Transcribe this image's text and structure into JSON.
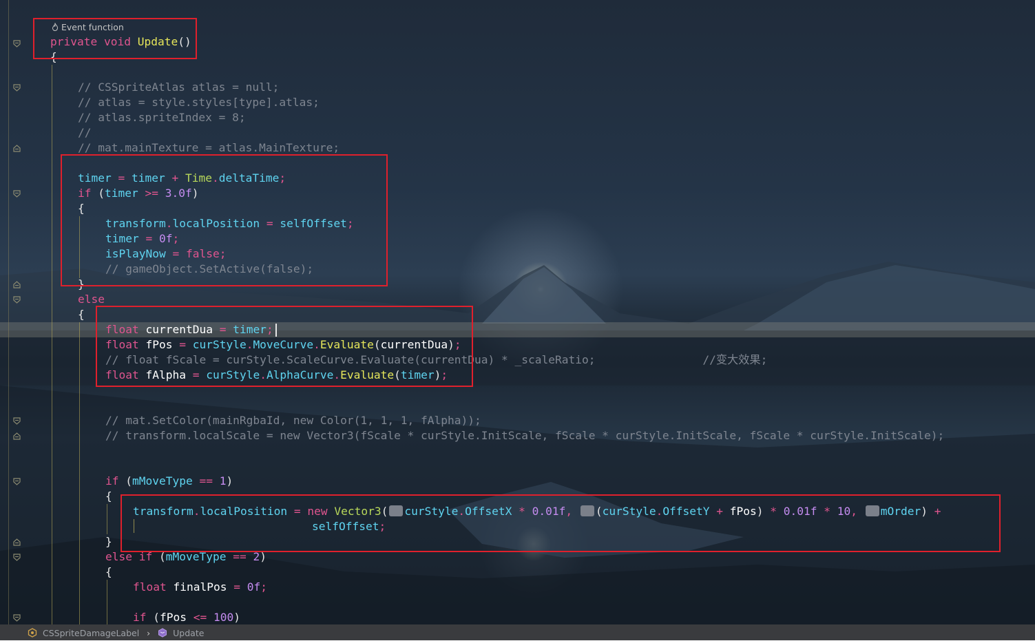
{
  "codelens": {
    "icon": "flame-icon",
    "label": "Event function"
  },
  "lines": [
    {
      "id": "l1",
      "tokens": [
        [
          "t-kw",
          "private"
        ],
        [
          "t-p",
          " "
        ],
        [
          "t-kw",
          "void"
        ],
        [
          "t-p",
          " "
        ],
        [
          "t-fn",
          "Update"
        ],
        [
          "t-p",
          "()"
        ]
      ]
    },
    {
      "id": "l2",
      "tokens": [
        [
          "t-p",
          "{"
        ]
      ]
    },
    {
      "id": "l3",
      "tokens": [
        [
          "t-cm",
          "// CSSpriteAtlas atlas = null;"
        ]
      ]
    },
    {
      "id": "l4",
      "tokens": [
        [
          "t-cm",
          "// atlas = style.styles[type].atlas;"
        ]
      ]
    },
    {
      "id": "l5",
      "tokens": [
        [
          "t-cm",
          "// atlas.spriteIndex = 8;"
        ]
      ]
    },
    {
      "id": "l6",
      "tokens": [
        [
          "t-cm",
          "//"
        ]
      ]
    },
    {
      "id": "l7",
      "tokens": [
        [
          "t-cm",
          "// mat.mainTexture = atlas.MainTexture;"
        ]
      ]
    },
    {
      "id": "l8",
      "tokens": [
        [
          "t-id",
          "timer"
        ],
        [
          "t-p",
          " "
        ],
        [
          "t-op",
          "="
        ],
        [
          "t-p",
          " "
        ],
        [
          "t-id",
          "timer"
        ],
        [
          "t-p",
          " "
        ],
        [
          "t-op",
          "+"
        ],
        [
          "t-p",
          " "
        ],
        [
          "t-type",
          "Time"
        ],
        [
          "t-op",
          "."
        ],
        [
          "t-id",
          "deltaTime"
        ],
        [
          "t-op",
          ";"
        ]
      ]
    },
    {
      "id": "l9",
      "tokens": [
        [
          "t-kw",
          "if"
        ],
        [
          "t-p",
          " ("
        ],
        [
          "t-id",
          "timer"
        ],
        [
          "t-p",
          " "
        ],
        [
          "t-op",
          ">="
        ],
        [
          "t-p",
          " "
        ],
        [
          "t-num",
          "3.0f"
        ],
        [
          "t-p",
          ")"
        ]
      ]
    },
    {
      "id": "l10",
      "tokens": [
        [
          "t-p",
          "{"
        ]
      ]
    },
    {
      "id": "l11",
      "tokens": [
        [
          "t-id",
          "transform"
        ],
        [
          "t-op",
          "."
        ],
        [
          "t-id",
          "localPosition"
        ],
        [
          "t-p",
          " "
        ],
        [
          "t-op",
          "="
        ],
        [
          "t-p",
          " "
        ],
        [
          "t-id",
          "selfOffset"
        ],
        [
          "t-op",
          ";"
        ]
      ]
    },
    {
      "id": "l12",
      "tokens": [
        [
          "t-id",
          "timer"
        ],
        [
          "t-p",
          " "
        ],
        [
          "t-op",
          "="
        ],
        [
          "t-p",
          " "
        ],
        [
          "t-num",
          "0f"
        ],
        [
          "t-op",
          ";"
        ]
      ]
    },
    {
      "id": "l13",
      "tokens": [
        [
          "t-id",
          "isPlayNow"
        ],
        [
          "t-p",
          " "
        ],
        [
          "t-op",
          "="
        ],
        [
          "t-p",
          " "
        ],
        [
          "t-kw",
          "false"
        ],
        [
          "t-op",
          ";"
        ]
      ]
    },
    {
      "id": "l14",
      "tokens": [
        [
          "t-cm",
          "// gameObject.SetActive(false);"
        ]
      ]
    },
    {
      "id": "l15",
      "tokens": [
        [
          "t-p",
          "}"
        ]
      ]
    },
    {
      "id": "l16",
      "tokens": [
        [
          "t-kw",
          "else"
        ]
      ]
    },
    {
      "id": "l17",
      "tokens": [
        [
          "t-p",
          "{"
        ]
      ]
    },
    {
      "id": "l18",
      "tokens": [
        [
          "t-kw",
          "float"
        ],
        [
          "t-p",
          " "
        ],
        [
          "t-w",
          "currentDua"
        ],
        [
          "t-p",
          " "
        ],
        [
          "t-op",
          "="
        ],
        [
          "t-p",
          " "
        ],
        [
          "t-id",
          "timer"
        ],
        [
          "t-op",
          ";"
        ]
      ]
    },
    {
      "id": "l19",
      "tokens": [
        [
          "t-kw",
          "float"
        ],
        [
          "t-p",
          " "
        ],
        [
          "t-w",
          "fPos"
        ],
        [
          "t-p",
          " "
        ],
        [
          "t-op",
          "="
        ],
        [
          "t-p",
          " "
        ],
        [
          "t-id",
          "curStyle"
        ],
        [
          "t-op",
          "."
        ],
        [
          "t-id",
          "MoveCurve"
        ],
        [
          "t-op",
          "."
        ],
        [
          "t-fn",
          "Evaluate"
        ],
        [
          "t-p",
          "("
        ],
        [
          "t-w",
          "currentDua"
        ],
        [
          "t-p",
          ")"
        ],
        [
          "t-op",
          ";"
        ]
      ]
    },
    {
      "id": "l20",
      "tokens": [
        [
          "t-cm",
          "// float fScale = curStyle.ScaleCurve.Evaluate(currentDua) * _scaleRatio;                //变大效果;"
        ]
      ]
    },
    {
      "id": "l21",
      "tokens": [
        [
          "t-kw",
          "float"
        ],
        [
          "t-p",
          " "
        ],
        [
          "t-w",
          "fAlpha"
        ],
        [
          "t-p",
          " "
        ],
        [
          "t-op",
          "="
        ],
        [
          "t-p",
          " "
        ],
        [
          "t-id",
          "curStyle"
        ],
        [
          "t-op",
          "."
        ],
        [
          "t-id",
          "AlphaCurve"
        ],
        [
          "t-op",
          "."
        ],
        [
          "t-fn",
          "Evaluate"
        ],
        [
          "t-p",
          "("
        ],
        [
          "t-id",
          "timer"
        ],
        [
          "t-p",
          ")"
        ],
        [
          "t-op",
          ";"
        ]
      ]
    },
    {
      "id": "l22",
      "tokens": [
        [
          "t-cm",
          "// mat.SetColor(mainRgbaId, new Color(1, 1, 1, fAlpha));"
        ]
      ]
    },
    {
      "id": "l23",
      "tokens": [
        [
          "t-cm",
          "// transform.localScale = new Vector3(fScale * curStyle.InitScale, fScale * curStyle.InitScale, fScale * curStyle.InitScale);"
        ]
      ]
    },
    {
      "id": "l24",
      "tokens": [
        [
          "t-kw",
          "if"
        ],
        [
          "t-p",
          " ("
        ],
        [
          "t-id",
          "mMoveType"
        ],
        [
          "t-p",
          " "
        ],
        [
          "t-op",
          "=="
        ],
        [
          "t-p",
          " "
        ],
        [
          "t-num",
          "1"
        ],
        [
          "t-p",
          ")"
        ]
      ]
    },
    {
      "id": "l25",
      "tokens": [
        [
          "t-p",
          "{"
        ]
      ]
    },
    {
      "id": "l26",
      "tokens": [
        [
          "t-id",
          "transform"
        ],
        [
          "t-op",
          "."
        ],
        [
          "t-id",
          "localPosition"
        ],
        [
          "t-p",
          " "
        ],
        [
          "t-op",
          "="
        ],
        [
          "t-p",
          " "
        ],
        [
          "t-kw",
          "new"
        ],
        [
          "t-p",
          " "
        ],
        [
          "t-type",
          "Vector3"
        ],
        [
          "t-p",
          "("
        ],
        [
          "hint",
          ""
        ],
        [
          "t-id",
          "curStyle"
        ],
        [
          "t-op",
          "."
        ],
        [
          "t-id",
          "OffsetX"
        ],
        [
          "t-p",
          " "
        ],
        [
          "t-op",
          "*"
        ],
        [
          "t-p",
          " "
        ],
        [
          "t-num",
          "0.01f"
        ],
        [
          "t-op",
          ","
        ],
        [
          "t-p",
          " "
        ],
        [
          "hint",
          ""
        ],
        [
          "t-p",
          "("
        ],
        [
          "t-id",
          "curStyle"
        ],
        [
          "t-op",
          "."
        ],
        [
          "t-id",
          "OffsetY"
        ],
        [
          "t-p",
          " "
        ],
        [
          "t-op",
          "+"
        ],
        [
          "t-p",
          " "
        ],
        [
          "t-w",
          "fPos"
        ],
        [
          "t-p",
          ")"
        ],
        [
          "t-p",
          " "
        ],
        [
          "t-op",
          "*"
        ],
        [
          "t-p",
          " "
        ],
        [
          "t-num",
          "0.01f"
        ],
        [
          "t-p",
          " "
        ],
        [
          "t-op",
          "*"
        ],
        [
          "t-p",
          " "
        ],
        [
          "t-num",
          "10"
        ],
        [
          "t-op",
          ","
        ],
        [
          "t-p",
          " "
        ],
        [
          "hint",
          ""
        ],
        [
          "t-id",
          "mOrder"
        ],
        [
          "t-p",
          ")"
        ],
        [
          "t-p",
          " "
        ],
        [
          "t-op",
          "+"
        ]
      ]
    },
    {
      "id": "l27",
      "tokens": [
        [
          "t-id",
          "selfOffset"
        ],
        [
          "t-op",
          ";"
        ]
      ]
    },
    {
      "id": "l28",
      "tokens": [
        [
          "t-p",
          "}"
        ]
      ]
    },
    {
      "id": "l29",
      "tokens": [
        [
          "t-kw",
          "else"
        ],
        [
          "t-p",
          " "
        ],
        [
          "t-kw",
          "if"
        ],
        [
          "t-p",
          " ("
        ],
        [
          "t-id",
          "mMoveType"
        ],
        [
          "t-p",
          " "
        ],
        [
          "t-op",
          "=="
        ],
        [
          "t-p",
          " "
        ],
        [
          "t-num",
          "2"
        ],
        [
          "t-p",
          ")"
        ]
      ]
    },
    {
      "id": "l30",
      "tokens": [
        [
          "t-p",
          "{"
        ]
      ]
    },
    {
      "id": "l31",
      "tokens": [
        [
          "t-kw",
          "float"
        ],
        [
          "t-p",
          " "
        ],
        [
          "t-w",
          "finalPos"
        ],
        [
          "t-p",
          " "
        ],
        [
          "t-op",
          "="
        ],
        [
          "t-p",
          " "
        ],
        [
          "t-num",
          "0f"
        ],
        [
          "t-op",
          ";"
        ]
      ]
    },
    {
      "id": "l32",
      "tokens": [
        [
          "t-kw",
          "if"
        ],
        [
          "t-p",
          " ("
        ],
        [
          "t-w",
          "fPos"
        ],
        [
          "t-p",
          " "
        ],
        [
          "t-op",
          "<="
        ],
        [
          "t-p",
          " "
        ],
        [
          "t-num",
          "100"
        ],
        [
          "t-p",
          ")"
        ]
      ]
    }
  ],
  "status_bar": {
    "class_icon": "class-icon",
    "class_name": "CSSpriteDamageLabel",
    "separator": "›",
    "method_icon": "method-icon",
    "method_name": "Update"
  },
  "colors": {
    "highlight_box": "#e0202c",
    "keyword": "#e0558f",
    "identifier": "#5fd4f0",
    "function": "#e6e65a",
    "type": "#b8d85a",
    "number": "#c58cf0",
    "comment": "#7e8590"
  }
}
